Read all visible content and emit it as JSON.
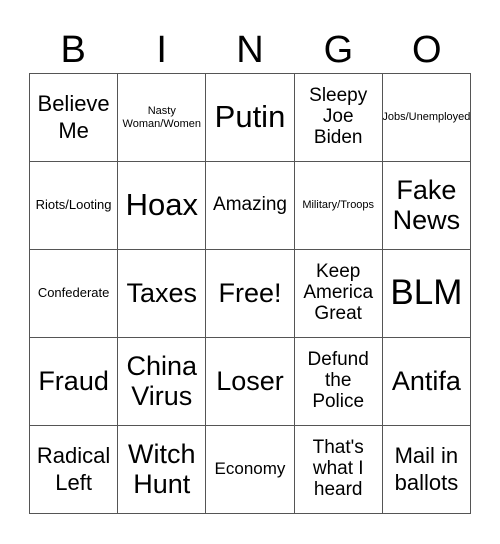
{
  "header": {
    "letters": [
      "B",
      "I",
      "N",
      "G",
      "O"
    ]
  },
  "cells": [
    {
      "text": "Believe Me",
      "size": "s-lg"
    },
    {
      "text": "Nasty Woman/Women",
      "size": "s-xs"
    },
    {
      "text": "Putin",
      "size": "s-xxl"
    },
    {
      "text": "Sleepy Joe Biden",
      "size": "s-ml"
    },
    {
      "text": "Jobs/Unemployed",
      "size": "s-xs"
    },
    {
      "text": "Riots/Looting",
      "size": "s-sm"
    },
    {
      "text": "Hoax",
      "size": "s-xxl"
    },
    {
      "text": "Amazing",
      "size": "s-ml"
    },
    {
      "text": "Military/Troops",
      "size": "s-xs"
    },
    {
      "text": "Fake News",
      "size": "s-xl"
    },
    {
      "text": "Confederate",
      "size": "s-sm"
    },
    {
      "text": "Taxes",
      "size": "s-xl"
    },
    {
      "text": "Free!",
      "size": "s-xl"
    },
    {
      "text": "Keep America Great",
      "size": "s-ml"
    },
    {
      "text": "BLM",
      "size": "s-xxxl"
    },
    {
      "text": "Fraud",
      "size": "s-xl"
    },
    {
      "text": "China Virus",
      "size": "s-xl"
    },
    {
      "text": "Loser",
      "size": "s-xl"
    },
    {
      "text": "Defund the Police",
      "size": "s-ml"
    },
    {
      "text": "Antifa",
      "size": "s-xl"
    },
    {
      "text": "Radical Left",
      "size": "s-lg"
    },
    {
      "text": "Witch Hunt",
      "size": "s-xl"
    },
    {
      "text": "Economy",
      "size": "s-md"
    },
    {
      "text": "That's what I heard",
      "size": "s-ml"
    },
    {
      "text": "Mail in ballots",
      "size": "s-lg"
    }
  ]
}
